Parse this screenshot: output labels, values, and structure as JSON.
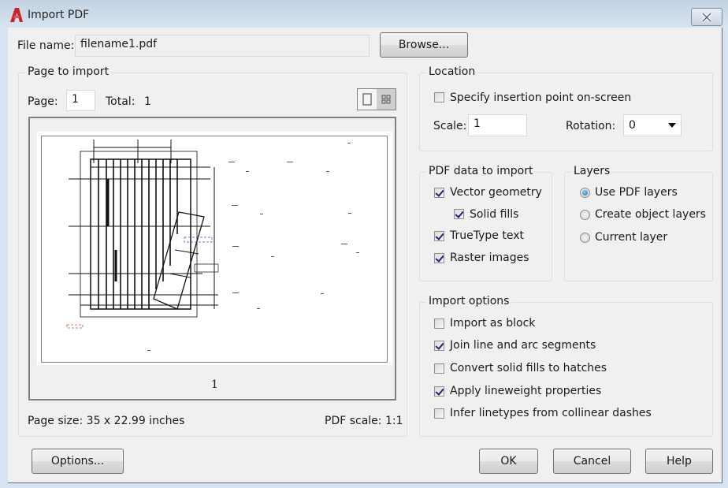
{
  "window": {
    "title": "Import PDF",
    "app_icon": "autocad-logo-icon",
    "close_icon": "close-icon"
  },
  "file": {
    "label": "File name:",
    "value": "filename1.pdf",
    "browse_label": "Browse..."
  },
  "page_to_import": {
    "title": "Page to import",
    "page_label": "Page:",
    "page_value": "1",
    "total_label": "Total:",
    "total_value": "1",
    "view_modes": [
      "single-page-icon",
      "thumbnail-grid-icon"
    ],
    "thumbnail_caption": "1",
    "page_size": "Page size:  35 x 22.99 inches",
    "pdf_scale": "PDF scale:  1:1"
  },
  "location": {
    "title": "Location",
    "specify_onscreen": {
      "label": "Specify insertion point on-screen",
      "checked": false
    },
    "scale_label": "Scale:",
    "scale_value": "1",
    "rotation_label": "Rotation:",
    "rotation_value": "0"
  },
  "pdf_data": {
    "title": "PDF data to import",
    "items": [
      {
        "label": "Vector geometry",
        "checked": true
      },
      {
        "label": "Solid fills",
        "checked": true
      },
      {
        "label": "TrueType text",
        "checked": true
      },
      {
        "label": "Raster images",
        "checked": true
      }
    ]
  },
  "layers": {
    "title": "Layers",
    "options": [
      {
        "label": "Use PDF layers",
        "selected": true
      },
      {
        "label": "Create object layers",
        "selected": false
      },
      {
        "label": "Current layer",
        "selected": false
      }
    ]
  },
  "import_options": {
    "title": "Import options",
    "items": [
      {
        "label": "Import as block",
        "checked": false
      },
      {
        "label": "Join line and arc segments",
        "checked": true
      },
      {
        "label": "Convert solid fills to hatches",
        "checked": false
      },
      {
        "label": "Apply lineweight properties",
        "checked": true
      },
      {
        "label": "Infer linetypes from collinear dashes",
        "checked": false
      }
    ]
  },
  "buttons": {
    "options": "Options...",
    "ok": "OK",
    "cancel": "Cancel",
    "help": "Help"
  }
}
